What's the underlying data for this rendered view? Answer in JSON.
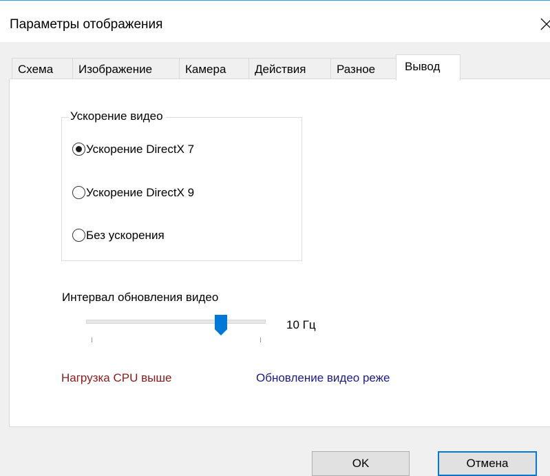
{
  "window": {
    "title": "Параметры отображения",
    "close_icon": "close-x-icon",
    "accent_color": "#2d9ee0"
  },
  "tabs": [
    {
      "label": "Схема",
      "active": false
    },
    {
      "label": "Изображение",
      "active": false
    },
    {
      "label": "Камера",
      "active": false
    },
    {
      "label": "Действия",
      "active": false
    },
    {
      "label": "Разное",
      "active": false
    },
    {
      "label": "Вывод",
      "active": true
    }
  ],
  "video_acceleration": {
    "group_label": "Ускорение видео",
    "options": [
      {
        "label": "Ускорение DirectX 7",
        "selected": true
      },
      {
        "label": "Ускорение DirectX 9",
        "selected": false
      },
      {
        "label": "Без ускорения",
        "selected": false
      }
    ]
  },
  "refresh_interval": {
    "label": "Интервал обновления видео",
    "value_text": "10 Гц",
    "slider_position_fraction": 0.75,
    "thumb_color": "#0078d7"
  },
  "hints": {
    "left": "Нагрузка CPU выше",
    "left_color": "#8b1a1a",
    "right": "Обновление видео реже",
    "right_color": "#1a1a8b"
  },
  "buttons": {
    "ok": "OK",
    "cancel": "Отмена",
    "default_border_color": "#0078d7"
  }
}
